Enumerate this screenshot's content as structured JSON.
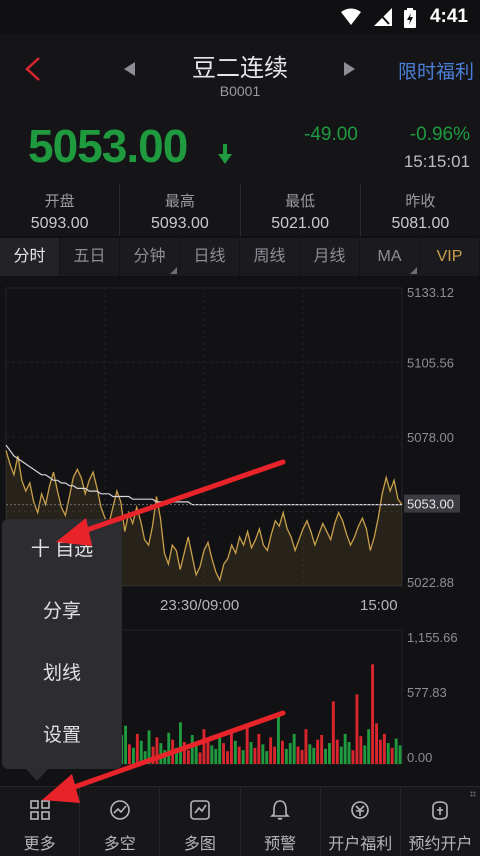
{
  "status_bar": {
    "time": "4:41",
    "icons": [
      "wifi-icon",
      "signal-icon",
      "battery-icon"
    ]
  },
  "header": {
    "title": "豆二连续",
    "code": "B0001",
    "promo": "限时福利"
  },
  "quote": {
    "price": "5053.00",
    "change": "-49.00",
    "change_pct": "-0.96%",
    "time": "15:15:01",
    "direction": "down",
    "color": "#1f9a3f"
  },
  "stats": [
    {
      "label": "开盘",
      "value": "5093.00"
    },
    {
      "label": "最高",
      "value": "5093.00"
    },
    {
      "label": "最低",
      "value": "5021.00"
    },
    {
      "label": "昨收",
      "value": "5081.00"
    }
  ],
  "tabs": [
    {
      "label": "分时",
      "active": true
    },
    {
      "label": "五日"
    },
    {
      "label": "分钟",
      "dropdown": true
    },
    {
      "label": "日线"
    },
    {
      "label": "周线"
    },
    {
      "label": "月线"
    },
    {
      "label": "MA",
      "dropdown": true
    },
    {
      "label": "VIP",
      "highlight": true
    }
  ],
  "chart_data": {
    "type": "line",
    "price_axis_labels": [
      "5133.12",
      "5105.56",
      "5078.00",
      "5053.00",
      "5022.88"
    ],
    "price_axis_values": [
      5133.12,
      5105.56,
      5078.0,
      5053.0,
      5022.88
    ],
    "time_labels": [
      "23:30/09:00",
      "15:00"
    ],
    "current_price_label": "5053.00",
    "volume_axis_labels": [
      "1,155.66",
      "577.83",
      "0.00"
    ],
    "volume_axis_values": [
      1155.66,
      577.83,
      0
    ],
    "price_series": [
      5073,
      5068,
      5064,
      5071,
      5062,
      5058,
      5061,
      5054,
      5050,
      5057,
      5053,
      5060,
      5065,
      5058,
      5052,
      5049,
      5056,
      5063,
      5066,
      5063,
      5057,
      5062,
      5065,
      5059,
      5052,
      5048,
      5046,
      5052,
      5058,
      5054,
      5043,
      5050,
      5046,
      5052,
      5047,
      5040,
      5038,
      5045,
      5056,
      5048,
      5035,
      5031,
      5038,
      5036,
      5029,
      5035,
      5041,
      5034,
      5027,
      5030,
      5036,
      5039,
      5033,
      5028,
      5025,
      5031,
      5033,
      5038,
      5035,
      5041,
      5038,
      5043,
      5037,
      5040,
      5044,
      5038,
      5036,
      5042,
      5047,
      5045,
      5050,
      5044,
      5041,
      5036,
      5040,
      5044,
      5047,
      5043,
      5038,
      5042,
      5046,
      5043,
      5040,
      5046,
      5050,
      5047,
      5042,
      5038,
      5041,
      5045,
      5048,
      5044,
      5036,
      5041,
      5048,
      5057,
      5063,
      5058,
      5062,
      5055,
      5053
    ],
    "avg_series": [
      5075,
      5073,
      5071,
      5070,
      5069,
      5068,
      5067,
      5066,
      5065,
      5064,
      5064,
      5063,
      5062,
      5062,
      5061,
      5061,
      5060,
      5060,
      5059,
      5059,
      5059,
      5058,
      5058,
      5058,
      5057,
      5057,
      5057,
      5056,
      5056,
      5056,
      5056,
      5056,
      5055,
      5055,
      5055,
      5055,
      5055,
      5055,
      5054,
      5054,
      5054,
      5054,
      5054,
      5054,
      5054,
      5054,
      5054,
      5053,
      5053,
      5053,
      5053,
      5053,
      5053,
      5053,
      5053,
      5053,
      5053,
      5053,
      5053,
      5053,
      5053,
      5053,
      5053,
      5053,
      5053,
      5053,
      5053,
      5053,
      5053,
      5053,
      5053,
      5053,
      5053,
      5053,
      5053,
      5053,
      5053,
      5053,
      5053,
      5053,
      5053,
      5053,
      5053,
      5053,
      5053,
      5053,
      5053,
      5053,
      5053,
      5053,
      5053,
      5053,
      5053,
      5053,
      5053,
      5053,
      5053,
      5053,
      5053,
      5053,
      5053
    ],
    "volume_series": [
      320,
      150,
      260,
      90,
      180,
      210,
      120,
      300,
      160,
      240,
      110,
      200,
      90,
      170,
      260,
      140,
      380,
      220,
      150,
      100,
      280,
      190,
      130,
      400,
      230,
      160,
      310,
      180,
      120,
      250,
      330,
      170,
      140,
      260,
      200,
      110,
      290,
      150,
      230,
      180,
      120,
      270,
      210,
      140,
      360,
      190,
      120,
      250,
      170,
      100,
      300,
      220,
      160,
      130,
      240,
      180,
      110,
      280,
      200,
      150,
      120,
      320,
      190,
      140,
      260,
      170,
      110,
      230,
      150,
      420,
      200,
      130,
      180,
      260,
      150,
      120,
      300,
      170,
      140,
      210,
      250,
      130,
      180,
      540,
      210,
      150,
      260,
      190,
      120,
      600,
      240,
      160,
      300,
      860,
      350,
      210,
      260,
      180,
      140,
      220,
      160
    ]
  },
  "popup_menu": {
    "items": [
      "十 自选",
      "分享",
      "划线",
      "设置"
    ]
  },
  "bottom_nav": [
    {
      "label": "更多",
      "icon": "grid-icon"
    },
    {
      "label": "多空",
      "icon": "trend-icon"
    },
    {
      "label": "多图",
      "icon": "chart-icon"
    },
    {
      "label": "预警",
      "icon": "bell-icon"
    },
    {
      "label": "开户福利",
      "icon": "gift-icon"
    },
    {
      "label": "预约开户",
      "icon": "account-icon"
    }
  ],
  "colors": {
    "up": "#d8252e",
    "down": "#1f9a3f",
    "line": "#c9a04a",
    "avg": "#d6d6dc",
    "accent": "#4a7fd8",
    "arrow": "#e8232a"
  }
}
